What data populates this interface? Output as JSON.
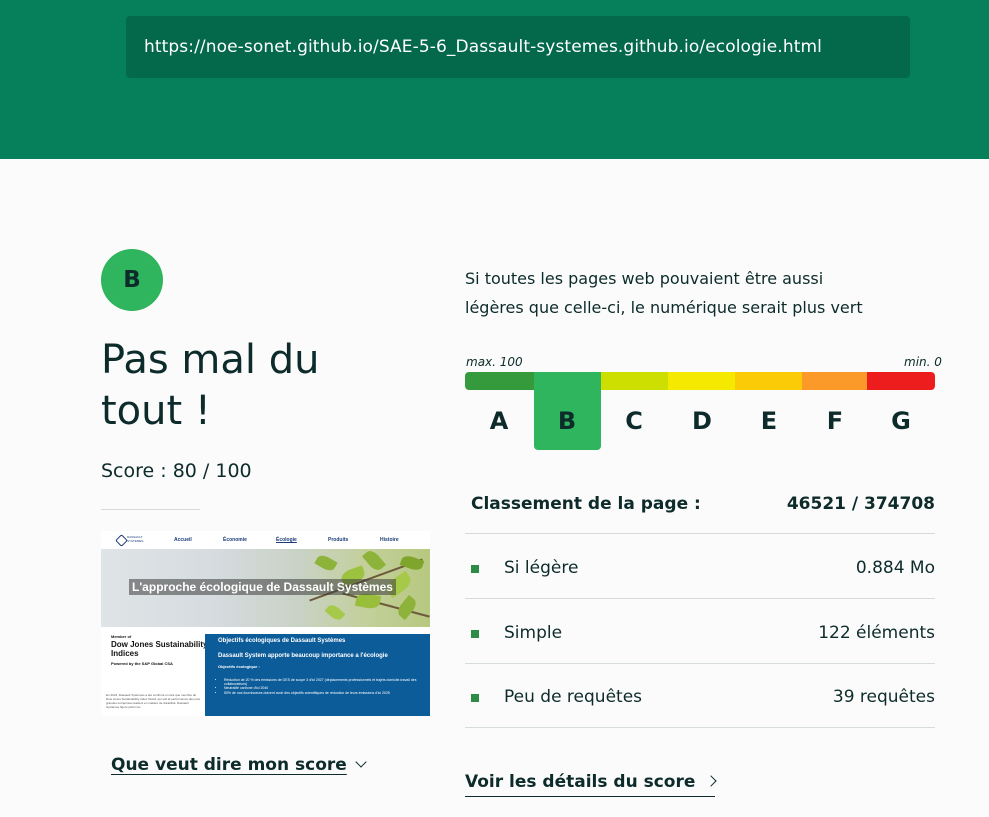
{
  "header": {
    "url": "https://noe-sonet.github.io/SAE-5-6_Dassault-systemes.github.io/ecologie.html"
  },
  "result": {
    "grade": "B",
    "headline": "Pas mal du tout !",
    "score_text": "Score : 80 / 100",
    "score": 80,
    "score_max": 100
  },
  "thumbnail": {
    "logo_text": "DASSAULT SYSTEMES",
    "nav": [
      "Accueil",
      "Économie",
      "Écologie",
      "Produits",
      "Histoire"
    ],
    "hero_title": "L'approche écologique de Dassault Systèmes",
    "member": "Member of",
    "dow_jones": "Dow Jones Sustainability Indices",
    "powered": "Powered by the S&P Global CSA",
    "left_paragraph": "En 2024, Dassault Systèmes a été confirmé en tant que membre du Dow Jones Sustainability index World, qui suit la performance des plus grandes entreprises leaders en matière de durabilité. Dassault Systèmes figure parmi les",
    "right_title": "Objectifs écologiques de Dassault Systèmes",
    "right_subtitle": "Dassault System apporte beaucoup importance a l'écologie",
    "right_label": "Objectifs écologique :",
    "bullets": [
      "Réduction de 20 % des émissions de GES de scope 3 d'ici 2027 (déplacements professionnels et trajets domicile-travail des collaborateurs)",
      "Neutralité carbone d'ici 2040",
      "50% de nos fournisseurs doivent avoir des objectifs scientifiques de réduction de leurs émissions d'ici 2025"
    ]
  },
  "links": {
    "score_meaning": "Que veut dire mon score",
    "score_details": "Voir les détails du score"
  },
  "intro": "Si toutes les pages web pouvaient être aussi légères que celle-ci, le numérique serait plus vert",
  "scale": {
    "max_label": "max. 100",
    "min_label": "min. 0",
    "selected": "B",
    "grades": [
      {
        "letter": "A",
        "color": "#349a3b"
      },
      {
        "letter": "B",
        "color": "#2fb55e"
      },
      {
        "letter": "C",
        "color": "#cddf00"
      },
      {
        "letter": "D",
        "color": "#f5e900"
      },
      {
        "letter": "E",
        "color": "#fccb08"
      },
      {
        "letter": "F",
        "color": "#fb9929"
      },
      {
        "letter": "G",
        "color": "#ee1d1d"
      }
    ]
  },
  "ranking": {
    "label": "Classement de la page :",
    "value": "46521 / 374708"
  },
  "metrics": [
    {
      "label": "Si légère",
      "value": "0.884 Mo"
    },
    {
      "label": "Simple",
      "value": "122 éléments"
    },
    {
      "label": "Peu de requêtes",
      "value": "39 requêtes"
    }
  ],
  "colors": {
    "header_bg": "#05805a",
    "url_box_bg": "#03694a",
    "accent_green": "#2fb55e",
    "bullet_green": "#2e8b45",
    "text_dark": "#0d2b2b"
  }
}
